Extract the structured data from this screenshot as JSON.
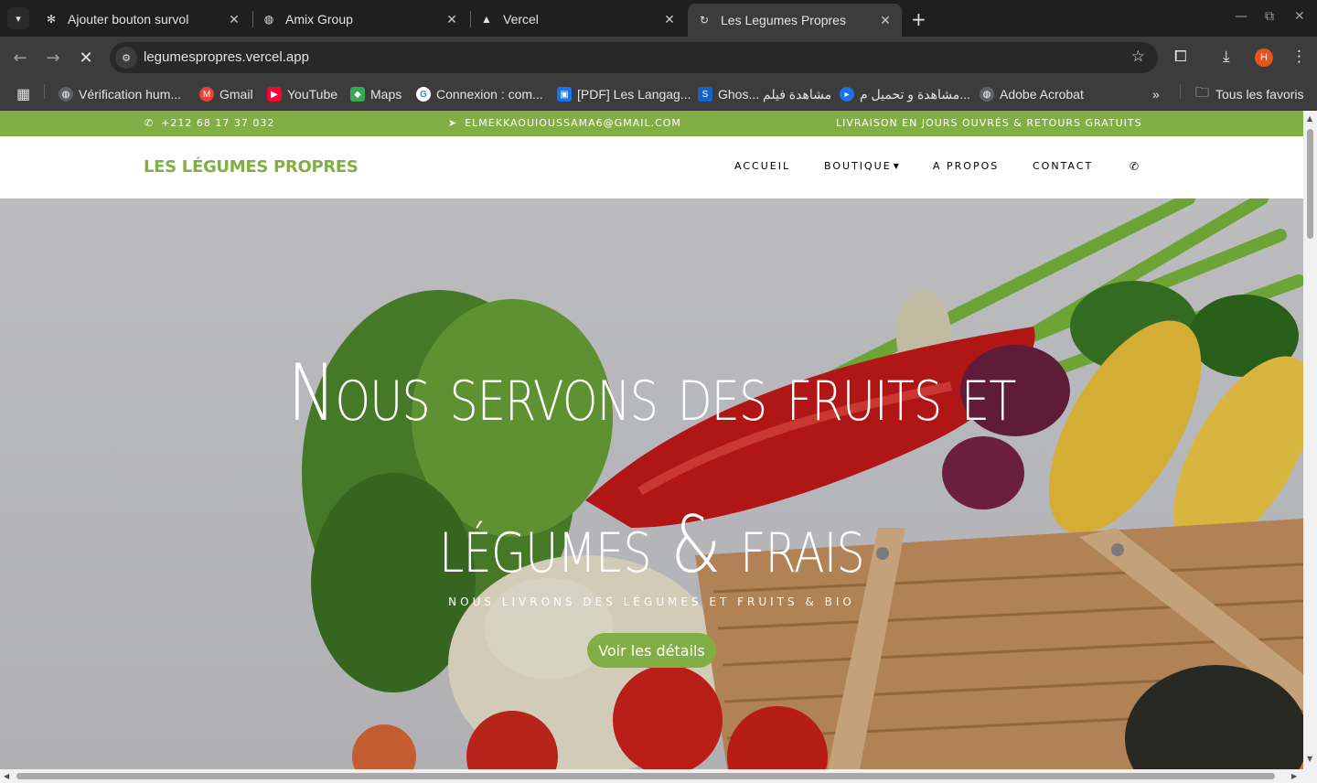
{
  "browser": {
    "tabs": [
      {
        "title": "Ajouter bouton survol",
        "icon": "openai-icon",
        "active": false
      },
      {
        "title": "Amix Group",
        "icon": "globe-icon",
        "active": false
      },
      {
        "title": "Vercel",
        "icon": "vercel-icon",
        "active": false
      },
      {
        "title": "Les Legumes Propres",
        "icon": "loading-icon",
        "active": true
      }
    ],
    "url": "legumespropres.vercel.app",
    "profile_initial": "H",
    "bookmarks": [
      {
        "label": "Vérification hum...",
        "icon": "globe-icon"
      },
      {
        "label": "Gmail",
        "icon": "gmail-icon"
      },
      {
        "label": "YouTube",
        "icon": "youtube-icon"
      },
      {
        "label": "Maps",
        "icon": "maps-icon"
      },
      {
        "label": "Connexion : com...",
        "icon": "google-icon"
      },
      {
        "label": "[PDF] Les Langag...",
        "icon": "pdf-icon"
      },
      {
        "label": "Ghos... مشاهدة فيلم",
        "icon": "s-icon"
      },
      {
        "label": "مشاهدة و تحميل م...",
        "icon": "play-icon"
      },
      {
        "label": "Adobe Acrobat",
        "icon": "globe-icon"
      }
    ],
    "all_bookmarks_label": "Tous les favoris"
  },
  "site": {
    "topbar": {
      "phone": "+212 68 17 37 032",
      "email": "ELMEKKAOUIOUSSAMA6@GMAIL.COM",
      "shipping": "LIVRAISON EN JOURS OUVRÉS & RETOURS GRATUITS"
    },
    "brand": "LES LÉGUMES PROPRES",
    "nav": {
      "home": "ACCUEIL",
      "shop": "BOUTIQUE",
      "about": "A PROPOS",
      "contact": "CONTACT"
    },
    "hero": {
      "title_line1": "Nous servons des fruits et",
      "title_line2": "légumes & frais",
      "subtitle": "NOUS LIVRONS DES LÉGUMES ET FRUITS & BIO",
      "button": "Voir les détails"
    },
    "colors": {
      "accent": "#82ae46",
      "tab_bar": "#1f1f1f",
      "toolbar": "#3c3c3c"
    }
  }
}
